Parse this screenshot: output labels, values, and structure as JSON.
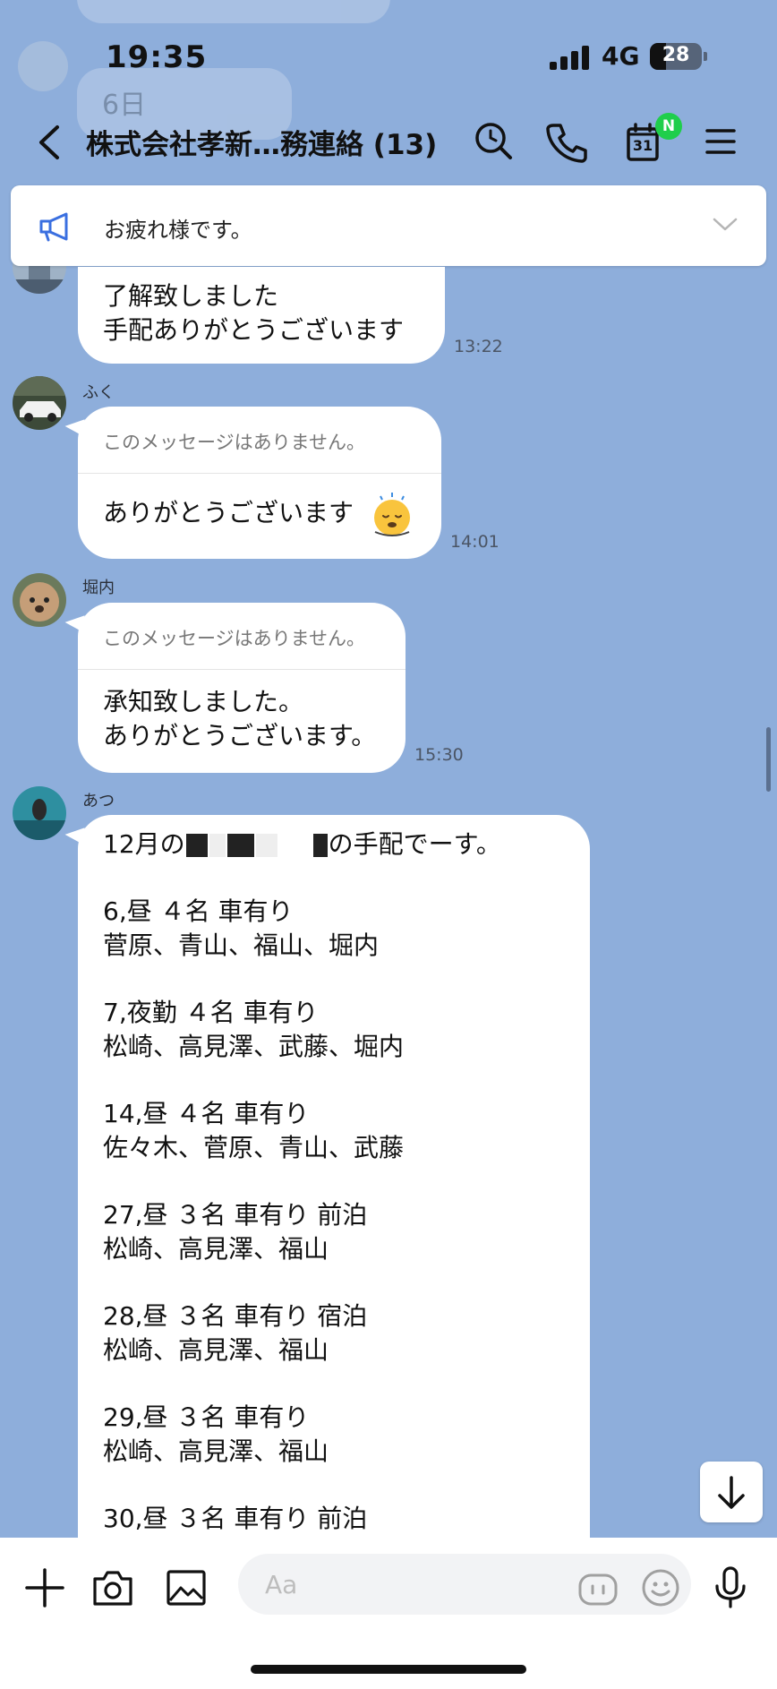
{
  "status_bar": {
    "time": "19:35",
    "network": "4G",
    "battery": "28"
  },
  "header": {
    "title": "株式会社孝新…務連絡 (13)",
    "calendar_day": "31",
    "calendar_badge": "N"
  },
  "announcement": {
    "text": "お疲れ様です。"
  },
  "background_preview": {
    "date_text": "6日"
  },
  "messages": [
    {
      "sender": "",
      "text": "了解致しました\n手配ありがとうございます",
      "time": "13:22"
    },
    {
      "sender": "ふく",
      "quote": "このメッセージはありません。",
      "text": "ありがとうございます",
      "time": "14:01"
    },
    {
      "sender": "堀内",
      "quote": "このメッセージはありません。",
      "text": "承知致しました。\nありがとうございます。",
      "time": "15:30"
    },
    {
      "sender": "あつ",
      "intro_start": "12月の",
      "intro_end": "の手配でーす。",
      "blocks": [
        {
          "head": "6,昼 ４名 車有り",
          "names": "菅原、青山、福山、堀内"
        },
        {
          "head": "7,夜勤 ４名 車有り",
          "names": "松崎、高見澤、武藤、堀内"
        },
        {
          "head": "14,昼 ４名 車有り",
          "names": "佐々木、菅原、青山、武藤"
        },
        {
          "head": "27,昼 ３名 車有り 前泊",
          "names": "松崎、高見澤、福山"
        },
        {
          "head": "28,昼 ３名 車有り 宿泊",
          "names": "松崎、高見澤、福山"
        },
        {
          "head": "29,昼 ３名 車有り",
          "names": "松崎、高見澤、福山"
        },
        {
          "head": "30,昼 ３名 車有り 前泊",
          "names": ""
        }
      ]
    }
  ],
  "input": {
    "placeholder": "Aa"
  }
}
